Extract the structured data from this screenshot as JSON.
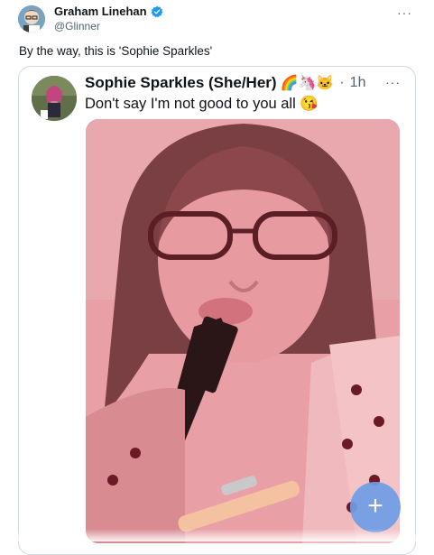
{
  "post": {
    "author": {
      "name": "Graham Linehan",
      "handle": "@Glinner"
    },
    "text": "By the way, this is 'Sophie Sparkles'",
    "more_label": "···"
  },
  "quoted": {
    "name": "Sophie Sparkles (She/Her)",
    "emoji": "🌈🦄🐱",
    "separator": "·",
    "time": "1h",
    "more_label": "···",
    "text": "Don't say I'm not good to you all 😘"
  },
  "fab": {
    "label": "+"
  },
  "colors": {
    "verified": "#1d9bf0",
    "fab": "#6f9ee6",
    "media_tint": "#e69fa4"
  }
}
